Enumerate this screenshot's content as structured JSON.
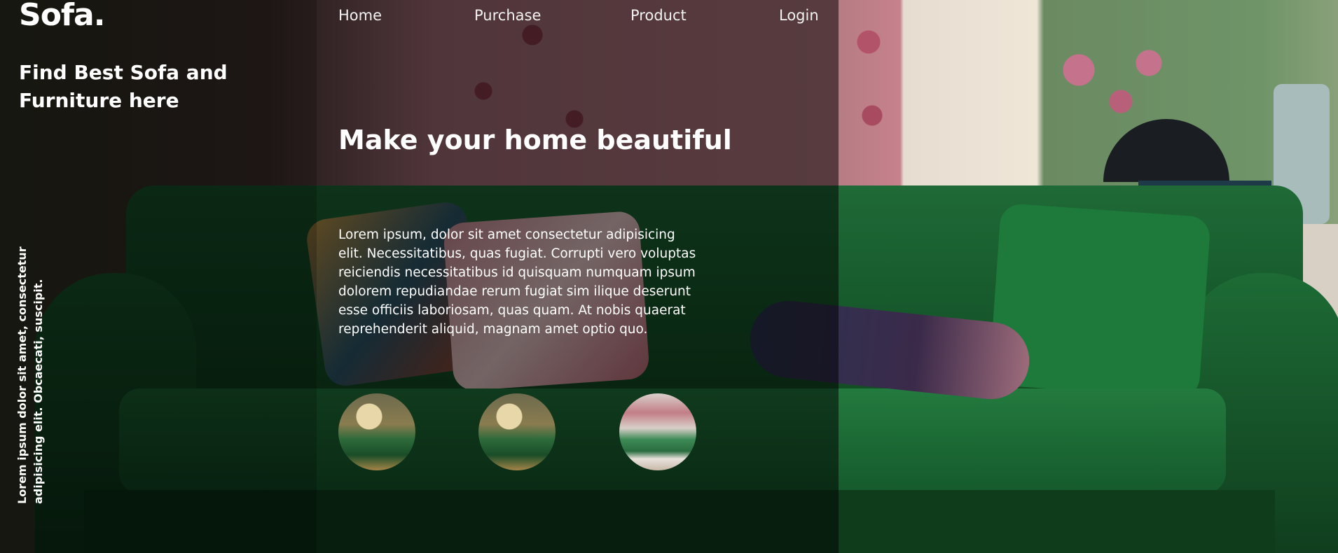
{
  "brand": {
    "name": "Sofa."
  },
  "hero": {
    "tagline": "Find Best Sofa and Furniture here",
    "vertical_text": "Lorem ipsum dolor sit amet, consectetur adipisicing elit. Obcaecati, suscipit."
  },
  "nav": {
    "items": [
      {
        "label": "Home"
      },
      {
        "label": "Purchase"
      },
      {
        "label": "Product"
      },
      {
        "label": "Login"
      }
    ]
  },
  "main": {
    "headline": "Make your home beautiful",
    "body": "Lorem ipsum, dolor sit amet consectetur adipisicing elit. Necessitatibus, quas fugiat. Corrupti vero voluptas reiciendis necessitatibus id quisquam numquam ipsum dolorem repudiandae rerum fugiat sim ilique deserunt esse officiis laboriosam, quas quam. At nobis quaerat reprehenderit aliquid, magnam amet optio quo.",
    "thumbnails": [
      {
        "name": "living-room-thumbnail"
      },
      {
        "name": "living-room-thumbnail"
      },
      {
        "name": "green-sofa-thumbnail"
      }
    ]
  },
  "colors": {
    "sofa_green": "#1e6b37",
    "overlay": "#000000",
    "text": "#ffffff"
  }
}
